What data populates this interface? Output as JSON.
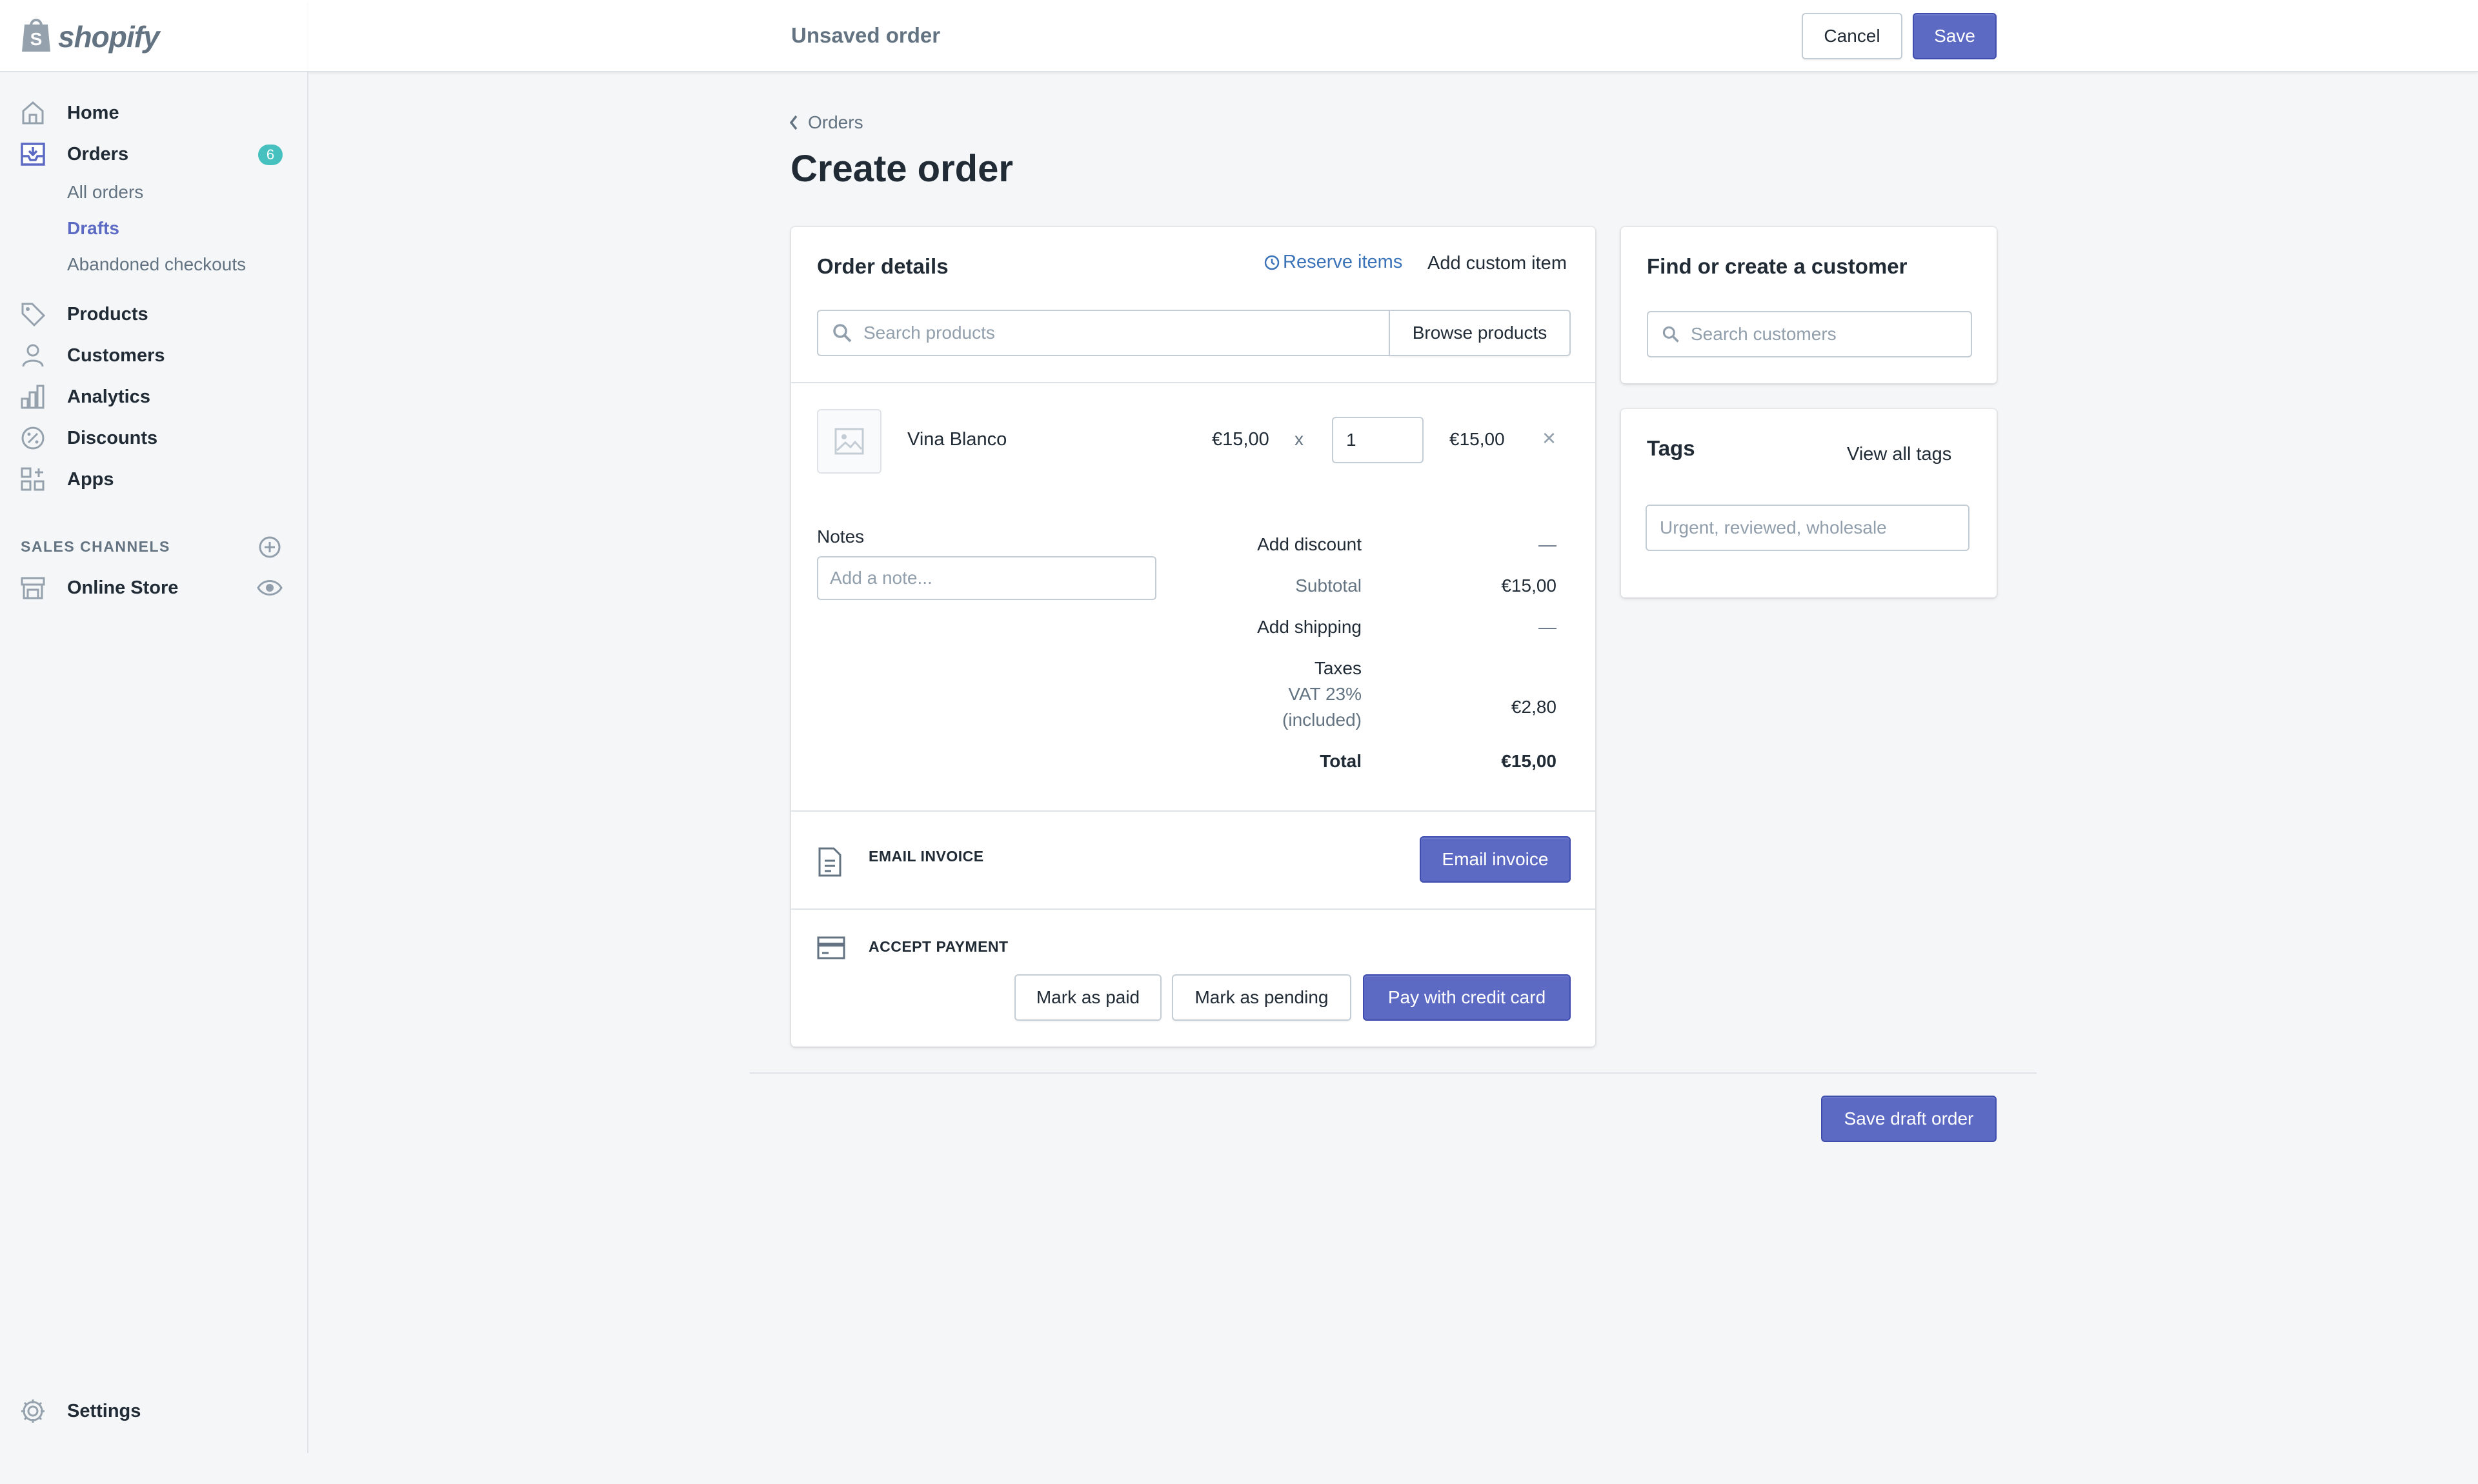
{
  "brand": {
    "name": "shopify"
  },
  "sidebar": {
    "items": [
      {
        "label": "Home",
        "icon": "home-icon"
      },
      {
        "label": "Orders",
        "icon": "orders-icon",
        "badge": "6"
      },
      {
        "label": "Products",
        "icon": "tag-icon"
      },
      {
        "label": "Customers",
        "icon": "person-icon"
      },
      {
        "label": "Analytics",
        "icon": "bar-chart-icon"
      },
      {
        "label": "Discounts",
        "icon": "discount-icon"
      },
      {
        "label": "Apps",
        "icon": "apps-icon"
      }
    ],
    "orders_sub": [
      "All orders",
      "Drafts",
      "Abandoned checkouts"
    ],
    "active_sub": "Drafts",
    "sales_channels_label": "SALES CHANNELS",
    "online_store_label": "Online Store",
    "settings_label": "Settings"
  },
  "topbar": {
    "title": "Unsaved order",
    "cancel_label": "Cancel",
    "save_label": "Save"
  },
  "page": {
    "breadcrumb": "Orders",
    "title": "Create order"
  },
  "order_details": {
    "title": "Order details",
    "reserve_items": "Reserve items",
    "add_custom_item": "Add custom item",
    "search_placeholder": "Search products",
    "browse_label": "Browse products",
    "line_item": {
      "name": "Vina Blanco",
      "price": "€15,00",
      "times": "x",
      "quantity": "1",
      "total": "€15,00",
      "remove": "×"
    },
    "notes_label": "Notes",
    "notes_placeholder": "Add a note...",
    "summary": {
      "add_discount": "Add discount",
      "discount_value": "—",
      "subtotal_label": "Subtotal",
      "subtotal_value": "€15,00",
      "add_shipping": "Add shipping",
      "shipping_value": "—",
      "taxes_label": "Taxes",
      "vat_label": "VAT 23%",
      "included_label": "(included)",
      "taxes_value": "€2,80",
      "total_label": "Total",
      "total_value": "€15,00"
    },
    "email_invoice_heading": "EMAIL INVOICE",
    "email_invoice_button": "Email invoice",
    "accept_payment_heading": "ACCEPT PAYMENT",
    "mark_paid": "Mark as paid",
    "mark_pending": "Mark as pending",
    "pay_card": "Pay with credit card"
  },
  "customer": {
    "title": "Find or create a customer",
    "search_placeholder": "Search customers"
  },
  "tags": {
    "title": "Tags",
    "view_all": "View all tags",
    "placeholder": "Urgent, reviewed, wholesale"
  },
  "footer": {
    "save_draft": "Save draft order"
  },
  "colors": {
    "primary": "#5c6ac4",
    "link": "#3b73b9",
    "badge": "#47c1bf",
    "background": "#f4f6f8"
  }
}
